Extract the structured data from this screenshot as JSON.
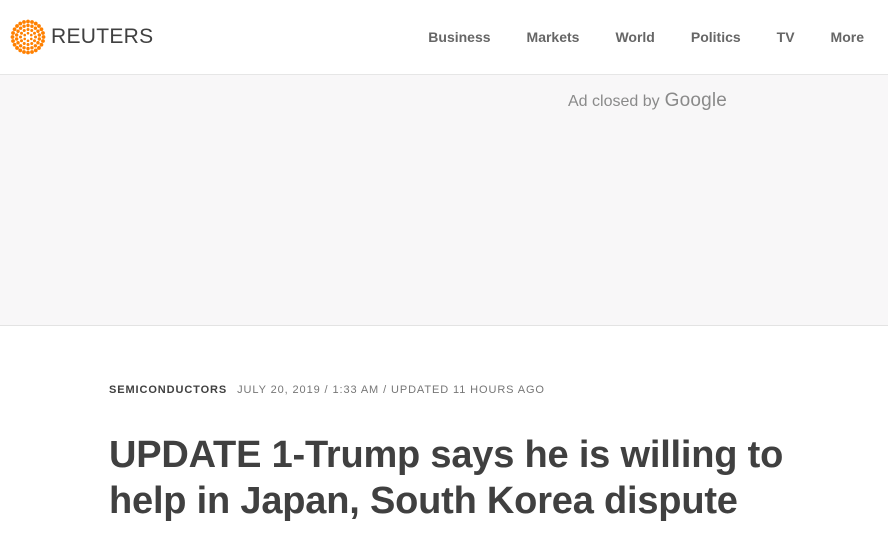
{
  "header": {
    "brand": "REUTERS",
    "nav": [
      {
        "label": "Business"
      },
      {
        "label": "Markets"
      },
      {
        "label": "World"
      },
      {
        "label": "Politics"
      },
      {
        "label": "TV"
      },
      {
        "label": "More"
      }
    ]
  },
  "ad": {
    "closed_text": "Ad closed by",
    "brand": "Google"
  },
  "article": {
    "section": "SEMICONDUCTORS",
    "date": "JULY 20, 2019 / 1:33 AM / UPDATED 11 HOURS AGO",
    "headline": "UPDATE 1-Trump says he is willing to help in Japan, South Korea dispute"
  },
  "colors": {
    "brand_orange": "#ff8000",
    "text": "#404040",
    "nav_text": "#666666",
    "ad_background": "#f8f7f8"
  }
}
